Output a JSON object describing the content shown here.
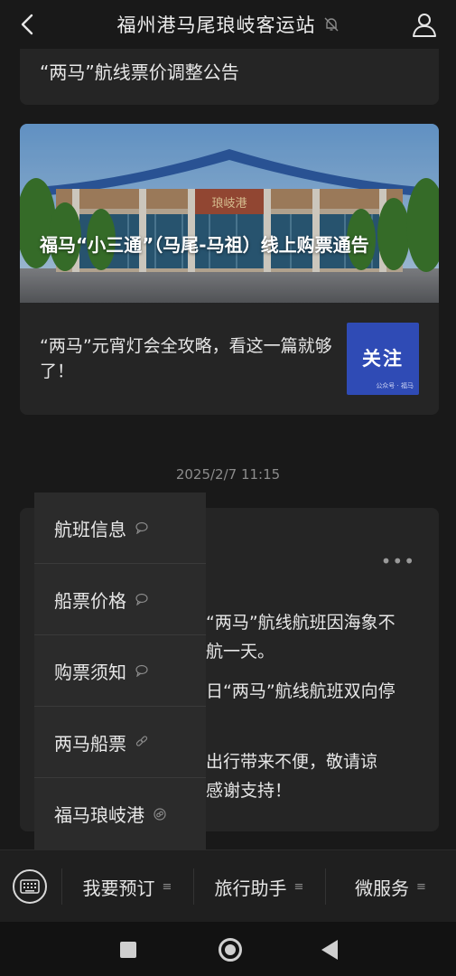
{
  "header": {
    "title": "福州港马尾琅岐客运站",
    "back_icon": "chevron-left-icon",
    "mute_icon": "bell-off-icon",
    "profile_icon": "user-icon"
  },
  "articles": {
    "top_item_title": "“两马”航线票价调整公告",
    "hero_title": "福马“小三通”（马尾-马祖）线上购票通告",
    "hero_sign_text": "琅岐港",
    "sub_title": "“两马”元宵灯会全攻略，看这一篇就够了！",
    "thumb_text": "关注",
    "thumb_small": "公众号 · 福马"
  },
  "timestamp": "2025/2/7 11:15",
  "message": {
    "more_label": "•••",
    "lines": [
      "“两马”航线航班因海象不",
      "航一天。",
      "日“两马”航线航班双向停",
      "出行带来不便，敬请谅",
      "感谢支持！"
    ]
  },
  "popup_menu": {
    "items": [
      {
        "label": "航班信息",
        "icon": "chat-bubble-icon"
      },
      {
        "label": "船票价格",
        "icon": "chat-bubble-icon"
      },
      {
        "label": "购票须知",
        "icon": "chat-bubble-icon"
      },
      {
        "label": "两马船票",
        "icon": "link-icon"
      },
      {
        "label": "福马琅岐港",
        "icon": "mini-program-icon"
      }
    ]
  },
  "menu_bar": {
    "keyboard_icon": "keyboard-icon",
    "items": [
      {
        "label": "我要预订",
        "icon": "≡"
      },
      {
        "label": "旅行助手",
        "icon": "≡"
      },
      {
        "label": "微服务",
        "icon": "≡"
      }
    ]
  },
  "android_nav": {
    "recent_icon": "square-icon",
    "home_icon": "circle-icon",
    "back_icon": "triangle-back-icon"
  },
  "colors": {
    "background": "#191919",
    "card": "#252525",
    "popup": "#2b2b2b",
    "thumb_blue": "#2f4bb5"
  }
}
